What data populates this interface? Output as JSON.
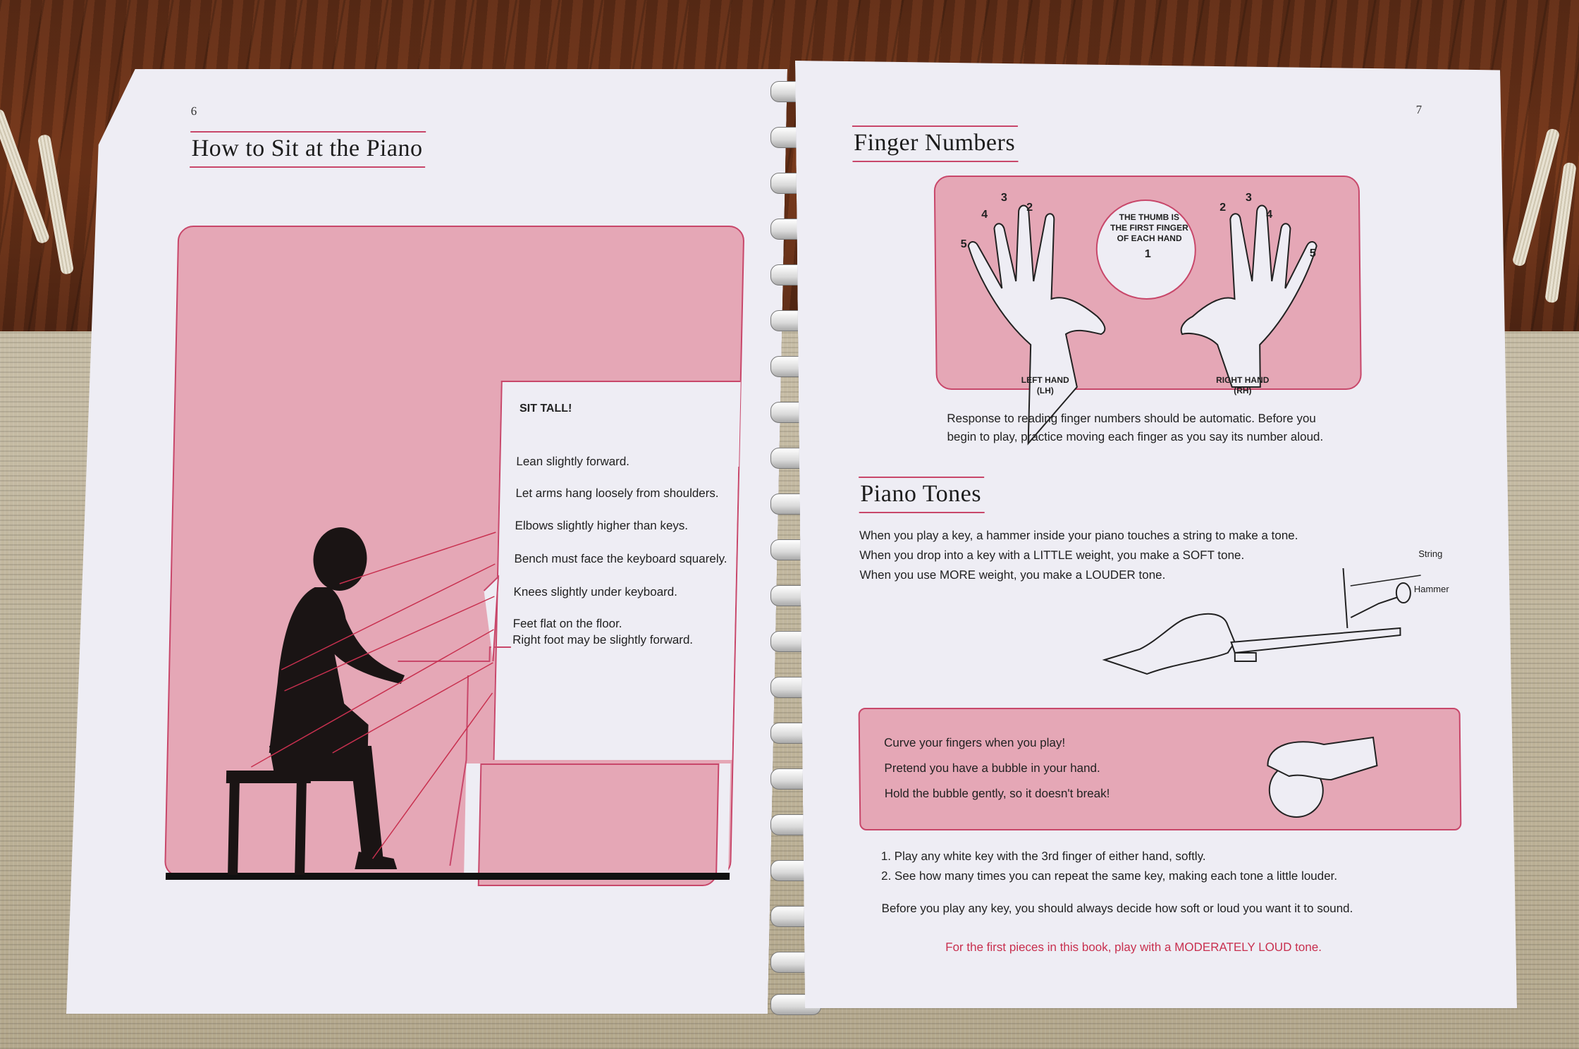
{
  "left_page": {
    "page_number": "6",
    "title": "How to Sit at the Piano",
    "heading": "SIT TALL!",
    "labels": [
      "Lean slightly forward.",
      "Let arms hang loosely from shoulders.",
      "Elbows slightly higher than keys.",
      "Bench must face the keyboard squarely.",
      "Knees slightly under keyboard.",
      "Feet flat on the floor.",
      "Right foot may be slightly forward."
    ]
  },
  "right_page": {
    "page_number": "7",
    "finger_numbers": {
      "title": "Finger Numbers",
      "thumb_note": [
        "THE THUMB IS",
        "THE FIRST FINGER",
        "OF EACH HAND"
      ],
      "left_hand_label": [
        "LEFT HAND",
        "(LH)"
      ],
      "right_hand_label": [
        "RIGHT HAND",
        "(RH)"
      ],
      "left_digits": [
        "5",
        "4",
        "3",
        "2",
        "1"
      ],
      "right_digits": [
        "2",
        "3",
        "4",
        "5"
      ],
      "caption": [
        "Response to reading finger numbers should be automatic.  Before you",
        "begin to play, practice moving each finger as you say its number aloud."
      ]
    },
    "piano_tones": {
      "title": "Piano Tones",
      "lines": [
        "When you play a key, a hammer inside your piano touches a string to make a tone.",
        "When you drop into a key with a LITTLE weight, you make a SOFT tone.",
        "When you use MORE weight, you make a LOUDER tone."
      ],
      "string_label": "String",
      "hammer_label": "Hammer"
    },
    "bubble_box": [
      "Curve your fingers when you play!",
      "Pretend you have a bubble in your hand.",
      "Hold the bubble gently, so it doesn't break!"
    ],
    "steps": [
      "1.  Play any white key with the 3rd finger of either hand, softly.",
      "2.  See how many times you can repeat the same key, making each tone a little louder."
    ],
    "decide_line": "Before you play any key, you should always decide how soft or loud you want it to sound.",
    "highlight_line": "For the first pieces in this book, play with a MODERATELY LOUD tone."
  },
  "colors": {
    "accent_pink": "#e5a7b6",
    "accent_red": "#c8476a",
    "paper": "#eeedf4"
  }
}
